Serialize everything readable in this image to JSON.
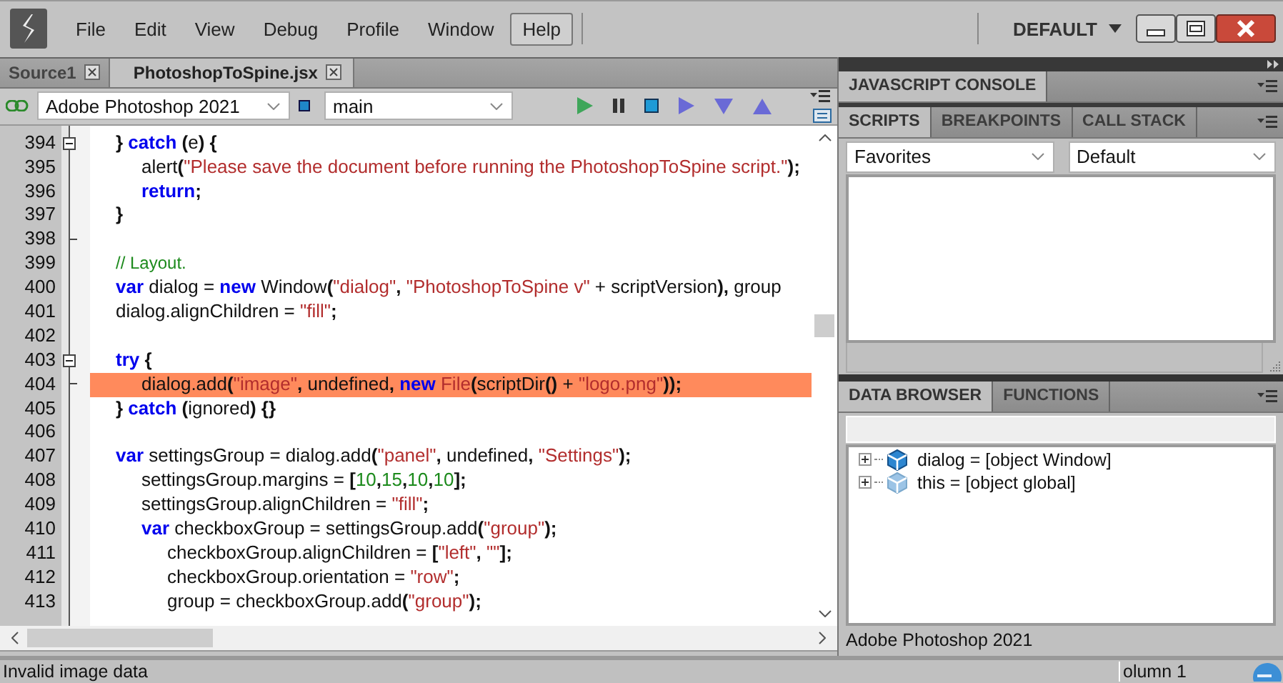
{
  "menu_bar": {
    "items": [
      {
        "label": "File",
        "selected": false
      },
      {
        "label": "Edit",
        "selected": false
      },
      {
        "label": "View",
        "selected": false
      },
      {
        "label": "Debug",
        "selected": false
      },
      {
        "label": "Profile",
        "selected": false
      },
      {
        "label": "Window",
        "selected": false
      },
      {
        "label": "Help",
        "selected": true
      }
    ],
    "workspace": "DEFAULT"
  },
  "document_tabs": [
    {
      "label": "Source1",
      "selected": false
    },
    {
      "label": "PhotoshopToSpine.jsx",
      "selected": true
    }
  ],
  "toolbar": {
    "target": "Adobe Photoshop 2021",
    "function": "main"
  },
  "editor": {
    "lines": [
      {
        "number": "394",
        "collapsible": true,
        "fold_end": false,
        "highlighted": false,
        "tokens": [
          {
            "kind": "op",
            "text": "\t} "
          },
          {
            "kind": "kw",
            "text": "catch "
          },
          {
            "kind": "op",
            "text": "("
          },
          {
            "kind": "id",
            "text": "e"
          },
          {
            "kind": "op",
            "text": ") {"
          }
        ]
      },
      {
        "number": "395",
        "collapsible": false,
        "fold_end": false,
        "highlighted": false,
        "tokens": [
          {
            "kind": "id",
            "text": "\t\talert"
          },
          {
            "kind": "op",
            "text": "("
          },
          {
            "kind": "str",
            "text": "\"Please save the document before running the PhotoshopToSpine script.\""
          },
          {
            "kind": "op",
            "text": ");"
          }
        ]
      },
      {
        "number": "396",
        "collapsible": false,
        "fold_end": false,
        "highlighted": false,
        "tokens": [
          {
            "kind": "kw",
            "text": "\t\treturn"
          },
          {
            "kind": "op",
            "text": ";"
          }
        ]
      },
      {
        "number": "397",
        "collapsible": false,
        "fold_end": false,
        "highlighted": false,
        "tokens": [
          {
            "kind": "op",
            "text": "\t}"
          }
        ]
      },
      {
        "number": "398",
        "collapsible": false,
        "fold_end": true,
        "highlighted": false
      },
      {
        "number": "399",
        "collapsible": false,
        "fold_end": false,
        "highlighted": false,
        "tokens": [
          {
            "kind": "com",
            "text": "\t// Layout."
          }
        ]
      },
      {
        "number": "400",
        "collapsible": false,
        "fold_end": false,
        "highlighted": false,
        "tokens": [
          {
            "kind": "kw",
            "text": "\tvar"
          },
          {
            "kind": "id",
            "text": " dialog = "
          },
          {
            "kind": "kw",
            "text": "new"
          },
          {
            "kind": "id",
            "text": " Window"
          },
          {
            "kind": "op",
            "text": "("
          },
          {
            "kind": "str",
            "text": "\"dialog\""
          },
          {
            "kind": "op",
            "text": ", "
          },
          {
            "kind": "str",
            "text": "\"PhotoshopToSpine v\""
          },
          {
            "kind": "id",
            "text": " + scriptVersion"
          },
          {
            "kind": "op",
            "text": "), "
          },
          {
            "kind": "id",
            "text": "group"
          }
        ]
      },
      {
        "number": "401",
        "collapsible": false,
        "fold_end": false,
        "highlighted": false,
        "tokens": [
          {
            "kind": "id",
            "text": "\tdialog.alignChildren = "
          },
          {
            "kind": "str",
            "text": "\"fill\""
          },
          {
            "kind": "op",
            "text": ";"
          }
        ]
      },
      {
        "number": "402",
        "collapsible": false,
        "fold_end": false,
        "highlighted": false
      },
      {
        "number": "403",
        "collapsible": true,
        "fold_end": false,
        "highlighted": false,
        "tokens": [
          {
            "kind": "kw",
            "text": "\ttry "
          },
          {
            "kind": "op",
            "text": "{"
          }
        ]
      },
      {
        "number": "404",
        "collapsible": false,
        "fold_end": true,
        "highlighted": true,
        "tokens": [
          {
            "kind": "id",
            "text": "\t\tdialog.add"
          },
          {
            "kind": "op",
            "text": "("
          },
          {
            "kind": "str",
            "text": "\"image\""
          },
          {
            "kind": "op",
            "text": ", "
          },
          {
            "kind": "id",
            "text": "undefined"
          },
          {
            "kind": "op",
            "text": ", "
          },
          {
            "kind": "kw",
            "text": "new "
          },
          {
            "kind": "type",
            "text": "File"
          },
          {
            "kind": "op",
            "text": "("
          },
          {
            "kind": "id",
            "text": "scriptDir"
          },
          {
            "kind": "op",
            "text": "()"
          },
          {
            "kind": "id",
            "text": " + "
          },
          {
            "kind": "str",
            "text": "\"logo.png\""
          },
          {
            "kind": "op",
            "text": "));"
          }
        ]
      },
      {
        "number": "405",
        "collapsible": false,
        "fold_end": false,
        "highlighted": false,
        "tokens": [
          {
            "kind": "op",
            "text": "\t} "
          },
          {
            "kind": "kw",
            "text": "catch "
          },
          {
            "kind": "op",
            "text": "("
          },
          {
            "kind": "id",
            "text": "ignored"
          },
          {
            "kind": "op",
            "text": ") {}"
          }
        ]
      },
      {
        "number": "406",
        "collapsible": false,
        "fold_end": false,
        "highlighted": false
      },
      {
        "number": "407",
        "collapsible": false,
        "fold_end": false,
        "highlighted": false,
        "tokens": [
          {
            "kind": "kw",
            "text": "\tvar"
          },
          {
            "kind": "id",
            "text": " settingsGroup = dialog.add"
          },
          {
            "kind": "op",
            "text": "("
          },
          {
            "kind": "str",
            "text": "\"panel\""
          },
          {
            "kind": "op",
            "text": ", "
          },
          {
            "kind": "id",
            "text": "undefined"
          },
          {
            "kind": "op",
            "text": ", "
          },
          {
            "kind": "str",
            "text": "\"Settings\""
          },
          {
            "kind": "op",
            "text": ");"
          }
        ]
      },
      {
        "number": "408",
        "collapsible": false,
        "fold_end": false,
        "highlighted": false,
        "tokens": [
          {
            "kind": "id",
            "text": "\t\tsettingsGroup.margins = "
          },
          {
            "kind": "op",
            "text": "["
          },
          {
            "kind": "num",
            "text": "10"
          },
          {
            "kind": "op",
            "text": ","
          },
          {
            "kind": "num",
            "text": "15"
          },
          {
            "kind": "op",
            "text": ","
          },
          {
            "kind": "num",
            "text": "10"
          },
          {
            "kind": "op",
            "text": ","
          },
          {
            "kind": "num",
            "text": "10"
          },
          {
            "kind": "op",
            "text": "];"
          }
        ]
      },
      {
        "number": "409",
        "collapsible": false,
        "fold_end": false,
        "highlighted": false,
        "tokens": [
          {
            "kind": "id",
            "text": "\t\tsettingsGroup.alignChildren = "
          },
          {
            "kind": "str",
            "text": "\"fill\""
          },
          {
            "kind": "op",
            "text": ";"
          }
        ]
      },
      {
        "number": "410",
        "collapsible": false,
        "fold_end": false,
        "highlighted": false,
        "tokens": [
          {
            "kind": "kw",
            "text": "\t\tvar"
          },
          {
            "kind": "id",
            "text": " checkboxGroup = settingsGroup.add"
          },
          {
            "kind": "op",
            "text": "("
          },
          {
            "kind": "str",
            "text": "\"group\""
          },
          {
            "kind": "op",
            "text": ");"
          }
        ]
      },
      {
        "number": "411",
        "collapsible": false,
        "fold_end": false,
        "highlighted": false,
        "tokens": [
          {
            "kind": "id",
            "text": "\t\t\tcheckboxGroup.alignChildren = "
          },
          {
            "kind": "op",
            "text": "["
          },
          {
            "kind": "str",
            "text": "\"left\""
          },
          {
            "kind": "op",
            "text": ", "
          },
          {
            "kind": "str",
            "text": "\"\""
          },
          {
            "kind": "op",
            "text": "];"
          }
        ]
      },
      {
        "number": "412",
        "collapsible": false,
        "fold_end": false,
        "highlighted": false,
        "tokens": [
          {
            "kind": "id",
            "text": "\t\t\tcheckboxGroup.orientation = "
          },
          {
            "kind": "str",
            "text": "\"row\""
          },
          {
            "kind": "op",
            "text": ";"
          }
        ]
      },
      {
        "number": "413",
        "collapsible": false,
        "fold_end": false,
        "highlighted": false,
        "tokens": [
          {
            "kind": "id",
            "text": "\t\t\tgroup = checkboxGroup.add"
          },
          {
            "kind": "op",
            "text": "("
          },
          {
            "kind": "str",
            "text": "\"group\""
          },
          {
            "kind": "op",
            "text": ");"
          }
        ]
      }
    ]
  },
  "status_bar": {
    "message": "Invalid image data",
    "position": "olumn 1"
  },
  "console_panel": {
    "tabs": [
      {
        "label": "JAVASCRIPT CONSOLE",
        "selected": true
      }
    ]
  },
  "scripts_panel": {
    "tabs": [
      {
        "label": "SCRIPTS",
        "selected": true
      },
      {
        "label": "BREAKPOINTS",
        "selected": false
      },
      {
        "label": "CALL STACK",
        "selected": false
      }
    ],
    "location": "Favorites",
    "filter": "Default"
  },
  "data_panel": {
    "tabs": [
      {
        "label": "DATA BROWSER",
        "selected": true
      },
      {
        "label": "FUNCTIONS",
        "selected": false
      }
    ],
    "tree": [
      {
        "label": "dialog = [object Window]",
        "expanded": false,
        "active": true
      },
      {
        "label": "this = [object global]",
        "expanded": false,
        "active": false
      }
    ],
    "footer": "Adobe Photoshop 2021"
  }
}
